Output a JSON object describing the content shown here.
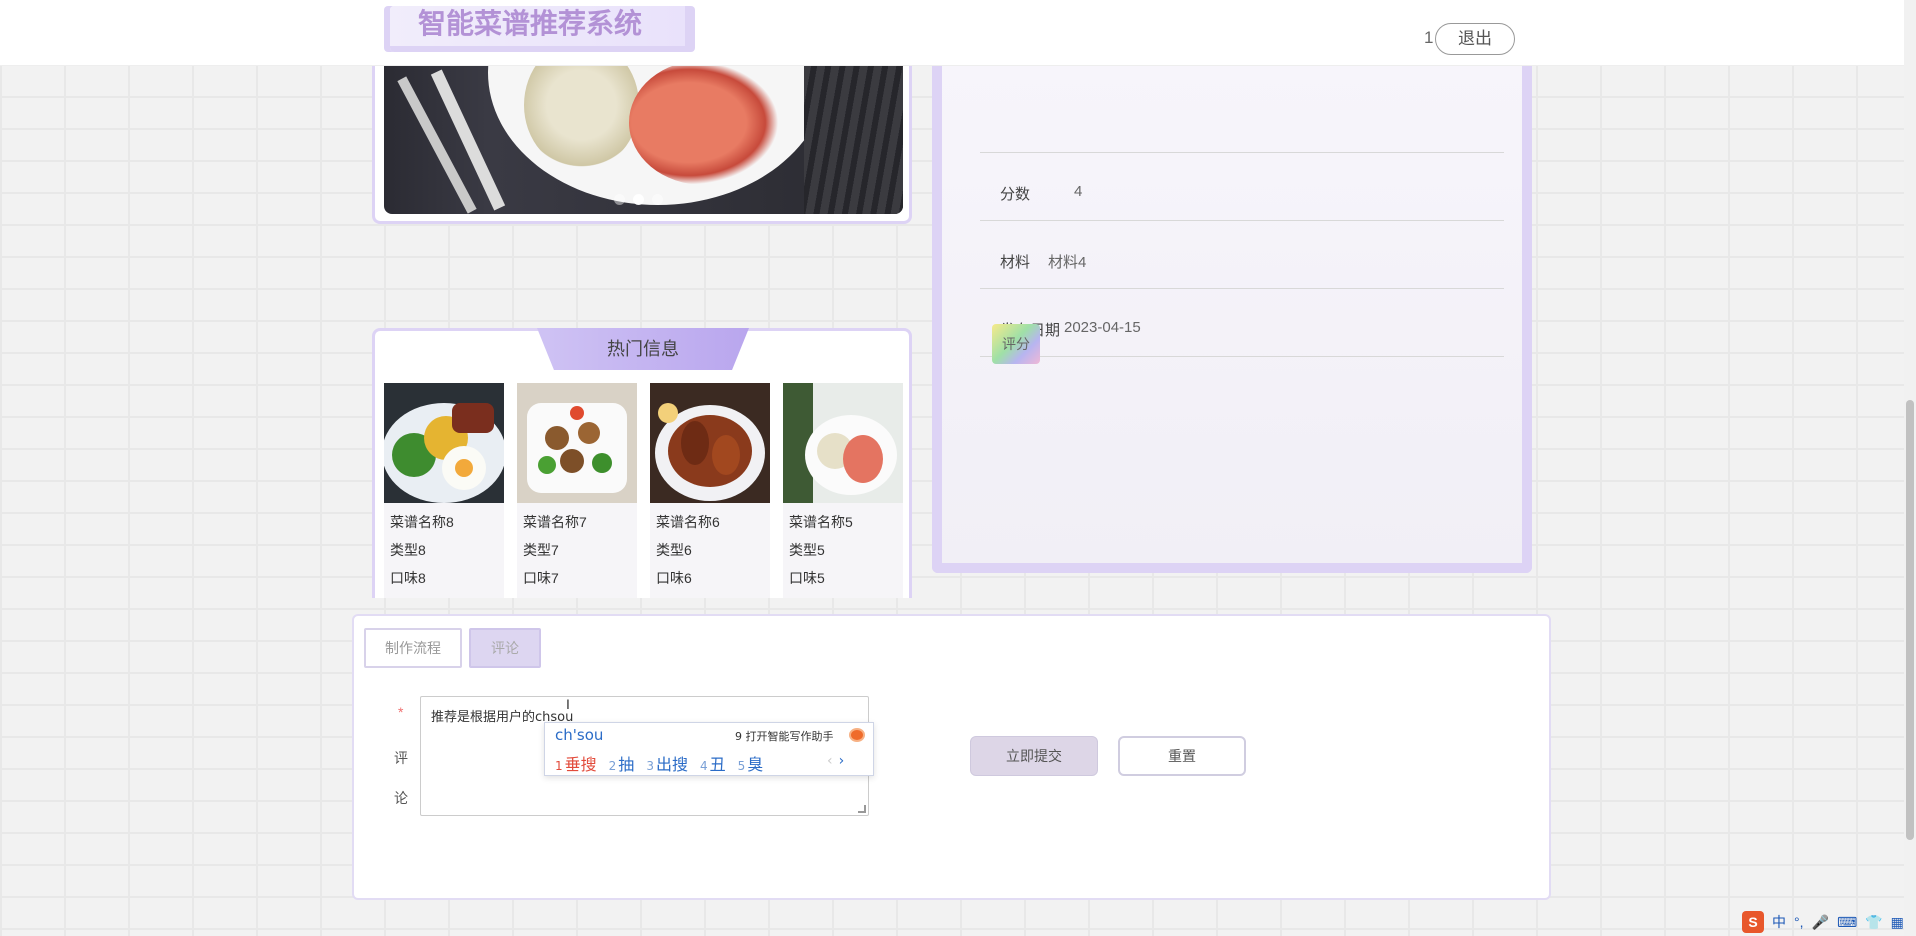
{
  "header": {
    "site_title": "智能菜谱推荐系统",
    "user_label": "1",
    "logout_label": "退出"
  },
  "info": {
    "rows": [
      {
        "key": "分数",
        "value": "4"
      },
      {
        "key": "材料",
        "value": "材料4"
      },
      {
        "key": "发布日期",
        "value": "2023-04-15"
      }
    ],
    "rate_button": "评分"
  },
  "hot": {
    "title": "热门信息",
    "items": [
      {
        "name": "菜谱名称8",
        "type": "类型8",
        "taste": "口味8"
      },
      {
        "name": "菜谱名称7",
        "type": "类型7",
        "taste": "口味7"
      },
      {
        "name": "菜谱名称6",
        "type": "类型6",
        "taste": "口味6"
      },
      {
        "name": "菜谱名称5",
        "type": "类型5",
        "taste": "口味5"
      }
    ]
  },
  "tabs": {
    "process": "制作流程",
    "comment": "评论"
  },
  "form": {
    "required_mark": "*",
    "label_char_1": "评",
    "label_char_2": "论",
    "comment_value": "推荐是根据用户的chsou",
    "submit_label": "立即提交",
    "reset_label": "重置"
  },
  "ime": {
    "input": "ch'sou",
    "assist": "9 打开智能写作助手",
    "candidates": [
      {
        "num": "1",
        "word": "垂搜"
      },
      {
        "num": "2",
        "word": "抽"
      },
      {
        "num": "3",
        "word": "出搜"
      },
      {
        "num": "4",
        "word": "丑"
      },
      {
        "num": "5",
        "word": "臭"
      }
    ]
  },
  "tray": {
    "ime_logo": "S",
    "lang": "中"
  }
}
